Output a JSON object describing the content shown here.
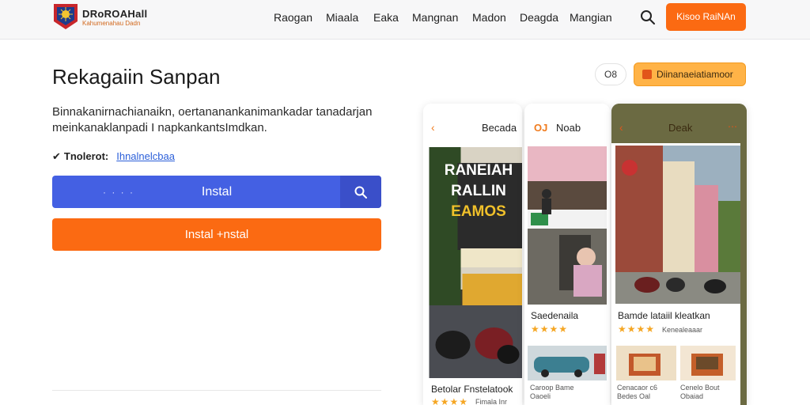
{
  "header": {
    "brand": "DRoROAHall",
    "brand_sub": "Kahumenahau Dadn",
    "nav": [
      "Raogan",
      "Miaala",
      "Eaka",
      "Mangnan",
      "Madon",
      "Deagda",
      "Mangian"
    ],
    "cta": "Kisoo RaiNAn"
  },
  "main": {
    "title": "Rekagaiin Sanpan",
    "description": "Binnakanirnachianaikn, oertananankanimankadar tanadarjan meinkanaklanpadi I napkankantsImdkan.",
    "meta_label": "Tnolerot:",
    "meta_link": "Ihnalnelcbaa",
    "install_dots": "· · · ·",
    "install_label": "Instal",
    "install_secondary": "Instal +nstal"
  },
  "controls": {
    "small_pill": "O8",
    "orange_pill": "Diinanaeiatiamoor"
  },
  "phones": [
    {
      "title": "Becada",
      "sign_lines": [
        "RANEIAH",
        "RALLIN",
        "EAMOS"
      ],
      "caption": "Betolar Fnstelatook",
      "rating_note": "Fimala Inr"
    },
    {
      "title": "Noab",
      "title_prefix": "OJ",
      "caption": "Saedenaila",
      "sub_left": [
        "Caroop Bame",
        "Oaoeli"
      ]
    },
    {
      "title": "Deak",
      "caption": "Bamde lataiil kleatkan",
      "rating_note": "Kenealeaaar",
      "sub_left": [
        "Cenacaor c6",
        "Bedes Oal"
      ],
      "sub_right": [
        "Cenelo Bout",
        "Obaiad"
      ]
    }
  ],
  "colors": {
    "accent_orange": "#fb6a12",
    "accent_blue": "#4460e3",
    "star": "#f5a623"
  }
}
